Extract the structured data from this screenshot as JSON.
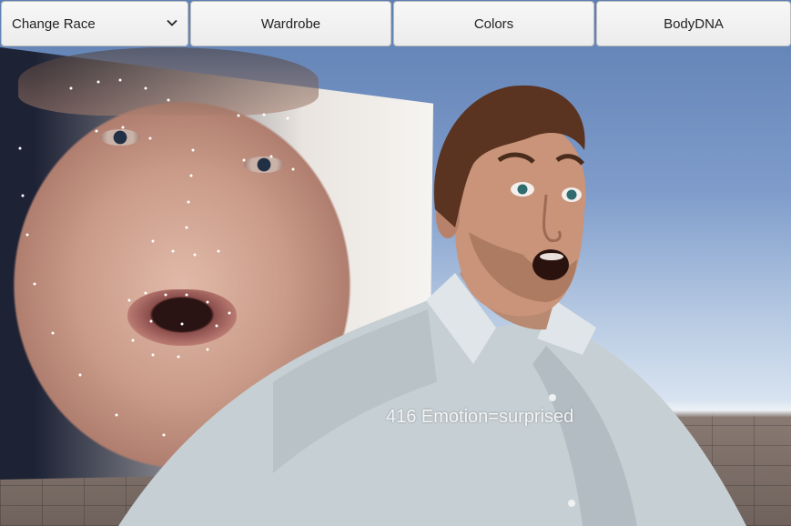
{
  "toolbar": {
    "race_dropdown": {
      "selected": "Change Race",
      "icon": "chevron-down-icon"
    },
    "wardrobe_label": "Wardrobe",
    "colors_label": "Colors",
    "bodydna_label": "BodyDNA"
  },
  "overlay": {
    "emotion_text": "416 Emotion=surprised"
  }
}
